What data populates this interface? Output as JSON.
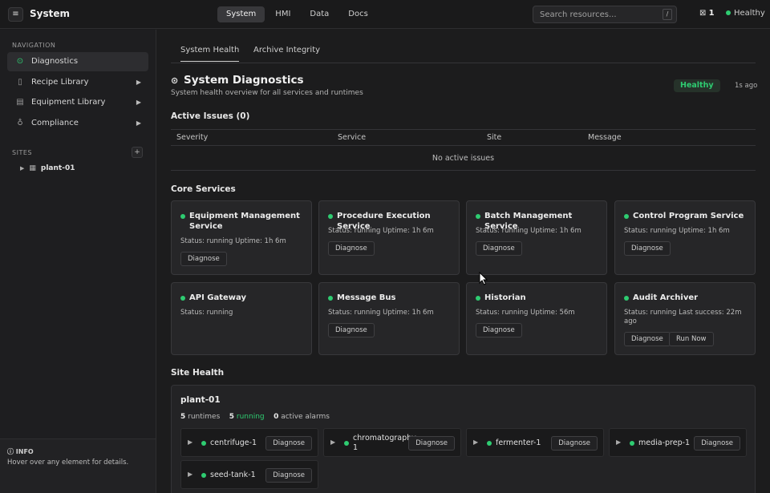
{
  "topbar": {
    "menu_icon": "hamburger-icon",
    "title": "System",
    "tabs": [
      {
        "label": "System",
        "active": true
      },
      {
        "label": "HMI",
        "active": false
      },
      {
        "label": "Data",
        "active": false
      },
      {
        "label": "Docs",
        "active": false
      }
    ],
    "search_placeholder": "Search resources...",
    "search_shortcut": "/",
    "notification_count": "1",
    "health_label": "Healthy"
  },
  "sidebar": {
    "nav_label": "NAVIGATION",
    "items": [
      {
        "label": "Diagnostics",
        "icon": "diagnostics-icon",
        "active": true
      },
      {
        "label": "Recipe Library",
        "icon": "book-icon"
      },
      {
        "label": "Equipment Library",
        "icon": "equipment-icon"
      },
      {
        "label": "Compliance",
        "icon": "award-icon"
      }
    ],
    "sites_label": "SITES",
    "add_site": "+",
    "sites": [
      {
        "name": "plant-01"
      }
    ],
    "info_title": "INFO",
    "info_text": "Hover over any element for details."
  },
  "main": {
    "tabs": [
      {
        "label": "System Health",
        "active": true
      },
      {
        "label": "Archive Integrity",
        "active": false
      }
    ],
    "title": "System Diagnostics",
    "subtitle": "System health overview for all services and runtimes",
    "status_badge": "Healthy",
    "updated_ago": "1s ago",
    "issues": {
      "heading": "Active Issues (0)",
      "columns": [
        "Severity",
        "Service",
        "Site",
        "Message"
      ],
      "empty_text": "No active issues"
    },
    "core_services_heading": "Core Services",
    "services": [
      {
        "name": "Equipment Management Service",
        "status": "Status: running   Uptime: 1h 6m",
        "buttons": [
          "Diagnose"
        ]
      },
      {
        "name": "Procedure Execution Service",
        "status": "Status: running   Uptime: 1h 6m",
        "buttons": [
          "Diagnose"
        ]
      },
      {
        "name": "Batch Management Service",
        "status": "Status: running   Uptime: 1h 6m",
        "buttons": [
          "Diagnose"
        ]
      },
      {
        "name": "Control Program Service",
        "status": "Status: running   Uptime: 1h 6m",
        "buttons": [
          "Diagnose"
        ]
      },
      {
        "name": "API Gateway",
        "status": "Status: running",
        "buttons": []
      },
      {
        "name": "Message Bus",
        "status": "Status: running   Uptime: 1h 6m",
        "buttons": [
          "Diagnose"
        ]
      },
      {
        "name": "Historian",
        "status": "Status: running   Uptime: 56m",
        "buttons": [
          "Diagnose"
        ]
      },
      {
        "name": "Audit Archiver",
        "status": "Status: running   Last success: 22m ago",
        "buttons": [
          "Diagnose",
          "Run Now"
        ]
      }
    ],
    "site_health_heading": "Site Health",
    "site": {
      "name": "plant-01",
      "runtimes_count": "5",
      "runtimes_label": "runtimes",
      "running_count": "5",
      "running_label": "running",
      "alarms_count": "0",
      "alarms_label": "active alarms",
      "runtimes": [
        {
          "name": "centrifuge-1",
          "button": "Diagnose"
        },
        {
          "name": "chromatography-1",
          "button": "Diagnose"
        },
        {
          "name": "fermenter-1",
          "button": "Diagnose"
        },
        {
          "name": "media-prep-1",
          "button": "Diagnose"
        },
        {
          "name": "seed-tank-1",
          "button": "Diagnose"
        }
      ]
    }
  },
  "colors": {
    "accent_green": "#2ecc71",
    "background": "#1c1c1d",
    "card": "#262628"
  }
}
